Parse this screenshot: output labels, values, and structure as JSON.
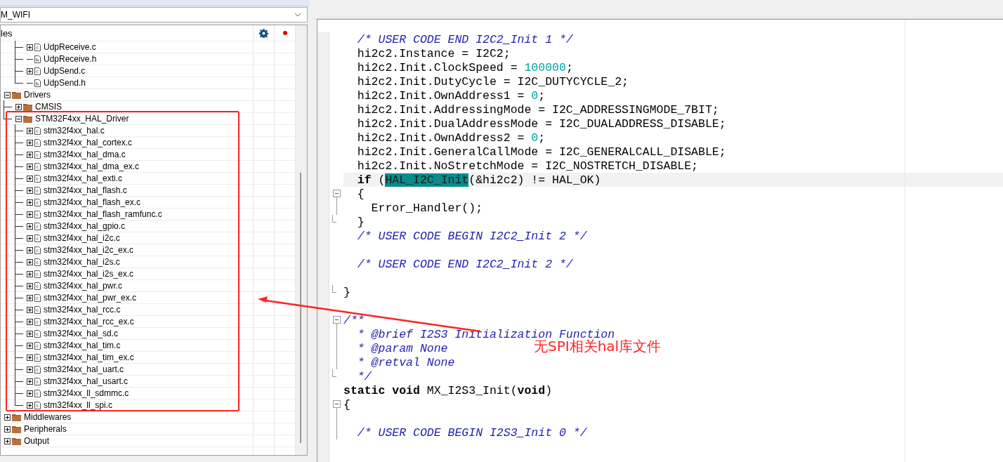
{
  "project_dropdown": {
    "value": "M_WIFI"
  },
  "project_panel": {
    "title": "les",
    "tree": [
      {
        "children": [
          {
            "children": [
              {
                "label": "UdpReceive.c",
                "kind": "c_file",
                "expanded": false
              },
              {
                "label": "UdpReceive.h",
                "kind": "h_file"
              },
              {
                "label": "UdpSend.c",
                "kind": "c_file",
                "expanded": false
              },
              {
                "label": "UdpSend.h",
                "kind": "h_file"
              }
            ]
          }
        ]
      },
      {
        "label": "Drivers",
        "kind": "folder",
        "expanded": true,
        "children": [
          {
            "label": "CMSIS",
            "kind": "folder",
            "expanded": false
          },
          {
            "label": "STM32F4xx_HAL_Driver",
            "kind": "folder",
            "expanded": true,
            "children": [
              {
                "label": "stm32f4xx_hal.c",
                "kind": "c_file",
                "expanded": false
              },
              {
                "label": "stm32f4xx_hal_cortex.c",
                "kind": "c_file",
                "expanded": false
              },
              {
                "label": "stm32f4xx_hal_dma.c",
                "kind": "c_file",
                "expanded": false
              },
              {
                "label": "stm32f4xx_hal_dma_ex.c",
                "kind": "c_file",
                "expanded": false
              },
              {
                "label": "stm32f4xx_hal_exti.c",
                "kind": "c_file",
                "expanded": false
              },
              {
                "label": "stm32f4xx_hal_flash.c",
                "kind": "c_file",
                "expanded": false
              },
              {
                "label": "stm32f4xx_hal_flash_ex.c",
                "kind": "c_file",
                "expanded": false
              },
              {
                "label": "stm32f4xx_hal_flash_ramfunc.c",
                "kind": "c_file",
                "expanded": false
              },
              {
                "label": "stm32f4xx_hal_gpio.c",
                "kind": "c_file",
                "expanded": false
              },
              {
                "label": "stm32f4xx_hal_i2c.c",
                "kind": "c_file",
                "expanded": false
              },
              {
                "label": "stm32f4xx_hal_i2c_ex.c",
                "kind": "c_file",
                "expanded": false
              },
              {
                "label": "stm32f4xx_hal_i2s.c",
                "kind": "c_file",
                "expanded": false
              },
              {
                "label": "stm32f4xx_hal_i2s_ex.c",
                "kind": "c_file",
                "expanded": false
              },
              {
                "label": "stm32f4xx_hal_pwr.c",
                "kind": "c_file",
                "expanded": false
              },
              {
                "label": "stm32f4xx_hal_pwr_ex.c",
                "kind": "c_file",
                "expanded": false
              },
              {
                "label": "stm32f4xx_hal_rcc.c",
                "kind": "c_file",
                "expanded": false
              },
              {
                "label": "stm32f4xx_hal_rcc_ex.c",
                "kind": "c_file",
                "expanded": false
              },
              {
                "label": "stm32f4xx_hal_sd.c",
                "kind": "c_file",
                "expanded": false
              },
              {
                "label": "stm32f4xx_hal_tim.c",
                "kind": "c_file",
                "expanded": false
              },
              {
                "label": "stm32f4xx_hal_tim_ex.c",
                "kind": "c_file",
                "expanded": false
              },
              {
                "label": "stm32f4xx_hal_uart.c",
                "kind": "c_file",
                "expanded": false
              },
              {
                "label": "stm32f4xx_hal_usart.c",
                "kind": "c_file",
                "expanded": false
              },
              {
                "label": "stm32f4xx_ll_sdmmc.c",
                "kind": "c_file",
                "expanded": false
              },
              {
                "label": "stm32f4xx_ll_spi.c",
                "kind": "c_file",
                "expanded": false
              }
            ]
          }
        ]
      },
      {
        "label": "Middlewares",
        "kind": "folder",
        "expanded": false
      },
      {
        "label": "Peripherals",
        "kind": "folder",
        "expanded": false
      },
      {
        "label": "Output",
        "kind": "folder",
        "expanded": false
      }
    ]
  },
  "editor": {
    "lines": [
      {
        "segments": [
          {
            "kind": "comment",
            "text": "  /* USER CODE END I2C2_Init 1 */"
          }
        ]
      },
      {
        "segments": [
          {
            "kind": "plain",
            "text": "  hi2c2.Instance = I2C2;"
          }
        ]
      },
      {
        "segments": [
          {
            "kind": "plain",
            "text": "  hi2c2.Init.ClockSpeed = "
          },
          {
            "kind": "number",
            "text": "100000"
          },
          {
            "kind": "plain",
            "text": ";"
          }
        ]
      },
      {
        "segments": [
          {
            "kind": "plain",
            "text": "  hi2c2.Init.DutyCycle = I2C_DUTYCYCLE_2;"
          }
        ]
      },
      {
        "segments": [
          {
            "kind": "plain",
            "text": "  hi2c2.Init.OwnAddress1 = "
          },
          {
            "kind": "number",
            "text": "0"
          },
          {
            "kind": "plain",
            "text": ";"
          }
        ]
      },
      {
        "segments": [
          {
            "kind": "plain",
            "text": "  hi2c2.Init.AddressingMode = I2C_ADDRESSINGMODE_7BIT;"
          }
        ]
      },
      {
        "segments": [
          {
            "kind": "plain",
            "text": "  hi2c2.Init.DualAddressMode = I2C_DUALADDRESS_DISABLE;"
          }
        ]
      },
      {
        "segments": [
          {
            "kind": "plain",
            "text": "  hi2c2.Init.OwnAddress2 = "
          },
          {
            "kind": "number",
            "text": "0"
          },
          {
            "kind": "plain",
            "text": ";"
          }
        ]
      },
      {
        "segments": [
          {
            "kind": "plain",
            "text": "  hi2c2.Init.GeneralCallMode = I2C_GENERALCALL_DISABLE;"
          }
        ]
      },
      {
        "segments": [
          {
            "kind": "plain",
            "text": "  hi2c2.Init.NoStretchMode = I2C_NOSTRETCH_DISABLE;"
          }
        ]
      },
      {
        "current": true,
        "segments": [
          {
            "kind": "keyword",
            "text": "  if"
          },
          {
            "kind": "plain",
            "text": " ("
          },
          {
            "kind": "selected",
            "text": "HAL_I2C_Init"
          },
          {
            "kind": "plain",
            "text": "(&hi2c2) != HAL_OK)"
          }
        ]
      },
      {
        "fold_open": true,
        "segments": [
          {
            "kind": "plain",
            "text": "  {"
          }
        ]
      },
      {
        "segments": [
          {
            "kind": "plain",
            "text": "    Error_Handler();"
          }
        ]
      },
      {
        "fold_end": true,
        "segments": [
          {
            "kind": "plain",
            "text": "  }"
          }
        ]
      },
      {
        "segments": [
          {
            "kind": "comment",
            "text": "  /* USER CODE BEGIN I2C2_Init 2 */"
          }
        ]
      },
      {
        "space_before": true,
        "segments": [
          {
            "kind": "comment",
            "text": "  /* USER CODE END I2C2_Init 2 */"
          }
        ]
      },
      {
        "space_before": true,
        "fold_end": true,
        "segments": [
          {
            "kind": "plain",
            "text": "}"
          }
        ]
      },
      {
        "space_before": true,
        "fold_open": true,
        "segments": [
          {
            "kind": "comment",
            "text": "/**"
          }
        ]
      },
      {
        "segments": [
          {
            "kind": "comment",
            "text": "  * @brief I2S3 Initialization Function"
          }
        ]
      },
      {
        "segments": [
          {
            "kind": "comment",
            "text": "  * @param None"
          }
        ]
      },
      {
        "segments": [
          {
            "kind": "comment",
            "text": "  * @retval None"
          }
        ]
      },
      {
        "fold_end": true,
        "segments": [
          {
            "kind": "comment",
            "text": "  */"
          }
        ]
      },
      {
        "segments": [
          {
            "kind": "keyword",
            "text": "static "
          },
          {
            "kind": "keyword",
            "text": "void"
          },
          {
            "kind": "plain",
            "text": " MX_I2S3_Init("
          },
          {
            "kind": "keyword",
            "text": "void"
          },
          {
            "kind": "plain",
            "text": ")"
          }
        ]
      },
      {
        "fold_open": true,
        "segments": [
          {
            "kind": "plain",
            "text": "{"
          }
        ]
      },
      {
        "space_before": true,
        "segments": [
          {
            "kind": "comment",
            "text": "  /* USER CODE BEGIN I2S3_Init 0 */"
          }
        ]
      }
    ]
  },
  "annotation": {
    "note": "无SPI相关hal库文件"
  }
}
